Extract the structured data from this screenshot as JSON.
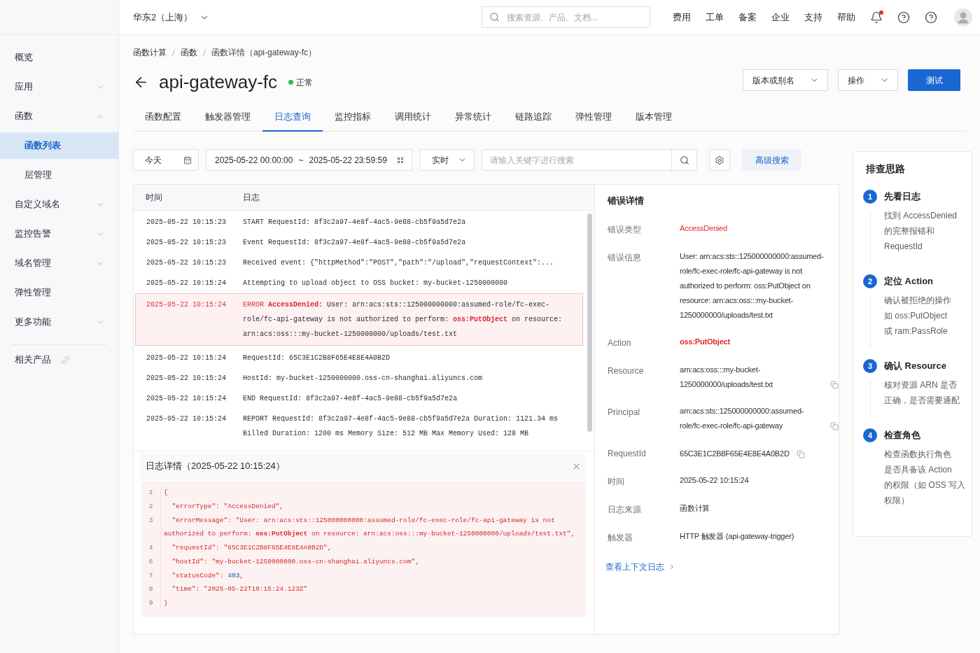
{
  "sidebar": {
    "items": [
      {
        "label": "概览",
        "kind": "link",
        "selected": false
      },
      {
        "label": "应用",
        "kind": "group",
        "expanded": false,
        "selected": false
      },
      {
        "label": "函数",
        "kind": "group",
        "expanded": true,
        "selected": false,
        "children": [
          {
            "label": "函数列表",
            "selected": true
          },
          {
            "label": "层管理",
            "selected": false
          }
        ]
      },
      {
        "label": "自定义域名",
        "kind": "group",
        "expanded": false,
        "selected": false
      },
      {
        "label": "监控告警",
        "kind": "group",
        "expanded": false,
        "selected": false
      },
      {
        "label": "域名管理",
        "kind": "group",
        "expanded": false,
        "selected": false
      },
      {
        "label": "弹性管理",
        "kind": "link",
        "selected": false
      },
      {
        "label": "更多功能",
        "kind": "group",
        "expanded": false,
        "selected": false
      }
    ],
    "footer_items": [
      {
        "label": "相关产品",
        "kind": "external",
        "selected": false
      }
    ]
  },
  "top_bar": {
    "region": "华东2（上海）",
    "search": {
      "placeholder": "搜索资源、产品、文档..."
    },
    "nav": [
      "费用",
      "工单",
      "备案",
      "企业",
      "支持",
      "帮助"
    ],
    "notifications": {
      "unread": true
    }
  },
  "breadcrumb": [
    "函数计算",
    "函数",
    "函数详情（api-gateway-fc）"
  ],
  "header": {
    "title": "api-gateway-fc",
    "status": {
      "label": "正常",
      "kind": "success"
    },
    "actions": [
      {
        "label": "版本或别名",
        "kind": "dropdown"
      },
      {
        "label": "操作",
        "kind": "dropdown"
      },
      {
        "label": "测试",
        "kind": "primary"
      }
    ]
  },
  "tabs": [
    {
      "label": "函数配置",
      "selected": false
    },
    {
      "label": "触发器管理",
      "selected": false
    },
    {
      "label": "日志查询",
      "selected": true
    },
    {
      "label": "监控指标",
      "selected": false
    },
    {
      "label": "调用统计",
      "selected": false
    },
    {
      "label": "异常统计",
      "selected": false
    },
    {
      "label": "链路追踪",
      "selected": false
    },
    {
      "label": "弹性管理",
      "selected": false
    },
    {
      "label": "版本管理",
      "selected": false
    }
  ],
  "filters": {
    "date_preset": "今天",
    "range": {
      "start": "2025-05-22 00:00:00",
      "separator": "~",
      "end": "2025-05-22 23:59:59"
    },
    "mode": "实时",
    "search": {
      "placeholder": "请输入关键字进行搜索"
    },
    "advanced_search": "高级搜索"
  },
  "log_table": {
    "columns": [
      "时间",
      "日志"
    ],
    "rows": [
      {
        "time": "2025-05-22 10:15:23",
        "message": "START RequestId: 8f3c2a97-4e8f-4ac5-9e88-cb5f9a5d7e2a",
        "kind": "info",
        "selected": false
      },
      {
        "time": "2025-05-22 10:15:23",
        "message": "Event RequestId: 8f3c2a97-4e8f-4ac5-9e88-cb5f9a5d7e2a",
        "kind": "info",
        "selected": false
      },
      {
        "time": "2025-05-22 10:15:23",
        "message": "Received event: {\"httpMethod\":\"POST\",\"path\":\"/upload\",\"requestContext\":...",
        "kind": "info",
        "selected": false
      },
      {
        "time": "2025-05-22 10:15:24",
        "message": "Attempting to upload object to OSS bucket: my-bucket-1250000000",
        "kind": "info",
        "selected": false
      },
      {
        "time": "2025-05-22 10:15:24",
        "tag": "ERROR",
        "message": "**AccessDenied:** User: arn:acs:sts::125000000000:assumed-role/fc-exec-role/fc-api-gateway is not authorized to perform: **oss:PutObject** on resource: arn:acs:oss:::my-bucket-1250000000/uploads/test.txt",
        "kind": "error",
        "selected": true
      },
      {
        "time": "2025-05-22 10:15:24",
        "message": "RequestId: 65C3E1C2B8F65E4E8E4A0B2D",
        "kind": "info",
        "selected": false
      },
      {
        "time": "2025-05-22 10:15:24",
        "message": "HostId: my-bucket-1250000000.oss-cn-shanghai.aliyuncs.com",
        "kind": "info",
        "selected": false
      },
      {
        "time": "2025-05-22 10:15:24",
        "message": "END RequestId: 8f3c2a97-4e8f-4ac5-9e88-cb5f9a5d7e2a",
        "kind": "info",
        "selected": false
      },
      {
        "time": "2025-05-22 10:15:24",
        "message": "REPORT RequestId: 8f3c2a97-4e8f-4ac5-9e88-cb5f9a5d7e2a Duration: 1121.34 ms Billed Duration: 1200 ms Memory Size: 512 MB Max Memory Used: 128 MB",
        "kind": "info",
        "selected": false
      }
    ]
  },
  "log_detail": {
    "title": "日志详情（2025-05-22 10:15:24）",
    "lines": [
      {
        "number": "1",
        "segments": [
          {
            "text": "{",
            "kind": "text"
          }
        ]
      },
      {
        "number": "2",
        "segments": [
          {
            "text": "  \"errorType\": \"AccessDenied\",",
            "kind": "text"
          }
        ]
      },
      {
        "number": "3",
        "segments": [
          {
            "text": "  \"errorMessage\": \"User: arn:acs:sts::125000000000:assumed-role/fc-exec-role/fc-api-gateway is not authorized to perform: **oss:PutObject** on resource: arn:acs:oss:::my-bucket-1250000000/uploads/test.txt\",",
            "kind": "text"
          }
        ]
      },
      {
        "number": "4",
        "segments": [
          {
            "text": "  \"requestId\": \"65C3E1C2B8F65E4E8E4A0B2D\",",
            "kind": "text"
          }
        ]
      },
      {
        "number": "6",
        "segments": [
          {
            "text": "  \"hostId\": \"my-bucket-1250000000.oss-cn-shanghai.aliyuncs.com\",",
            "kind": "text"
          }
        ]
      },
      {
        "number": "7",
        "segments": [
          {
            "text": "  \"statusCode\": ",
            "kind": "text"
          },
          {
            "text": "403",
            "kind": "number"
          },
          {
            "text": ",",
            "kind": "text"
          }
        ]
      },
      {
        "number": "8",
        "segments": [
          {
            "text": "  \"time\": \"2025-05-22T10:15:24.123Z\"",
            "kind": "text"
          }
        ]
      },
      {
        "number": "9",
        "segments": [
          {
            "text": "}",
            "kind": "text"
          }
        ]
      }
    ]
  },
  "error_details": {
    "title": "错误详情",
    "fields": [
      {
        "label": "错误类型",
        "value": "AccessDenied",
        "kind": "error",
        "copyable": false
      },
      {
        "label": "错误信息",
        "value": "User: arn:acs:sts::125000000000:assumed-role/fc-exec-role/fc-api-gateway is not authorized to perform: oss:PutObject on resource: arn:acs:oss:::my-bucket-1250000000/uploads/test.txt",
        "kind": "plain",
        "copyable": false
      },
      {
        "label": "Action",
        "value": "oss:PutObject",
        "kind": "error-strong",
        "copyable": false
      },
      {
        "label": "Resource",
        "value": "arn:acs:oss:::my-bucket-1250000000/uploads/test.txt",
        "kind": "plain",
        "copyable": true
      },
      {
        "label": "Principal",
        "value": "arn:acs:sts::125000000000:assumed-role/fc-exec-role/fc-api-gateway",
        "kind": "plain",
        "copyable": true
      },
      {
        "label": "RequestId",
        "value": "65C3E1C2B8F65E4E8E4A0B2D",
        "kind": "plain",
        "copyable": true
      },
      {
        "label": "时间",
        "value": "2025-05-22 10:15:24",
        "kind": "plain",
        "copyable": false
      },
      {
        "label": "日志来源",
        "value": "函数计算",
        "kind": "plain",
        "copyable": false
      },
      {
        "label": "触发器",
        "value": "HTTP 触发器 (api-gateway-trigger)",
        "kind": "plain",
        "copyable": false
      }
    ],
    "link": "查看上下文日志"
  },
  "troubleshooting": {
    "title": "排查思路",
    "steps": [
      {
        "number": "1",
        "title": "先看日志",
        "lines": [
          "找到 AccessDenied",
          "的完整报错和",
          "RequestId"
        ]
      },
      {
        "number": "2",
        "title": "定位 Action",
        "lines": [
          "确认被拒绝的操作",
          "如 oss:PutObject",
          "或 ram:PassRole"
        ]
      },
      {
        "number": "3",
        "title": "确认 Resource",
        "lines": [
          "核对资源 ARN 是否",
          "正确，是否需要通配"
        ]
      },
      {
        "number": "4",
        "title": "检查角色",
        "lines": [
          "检查函数执行角色",
          "是否具备该 Action",
          "的权限（如 OSS 写入",
          "权限）"
        ]
      }
    ]
  }
}
